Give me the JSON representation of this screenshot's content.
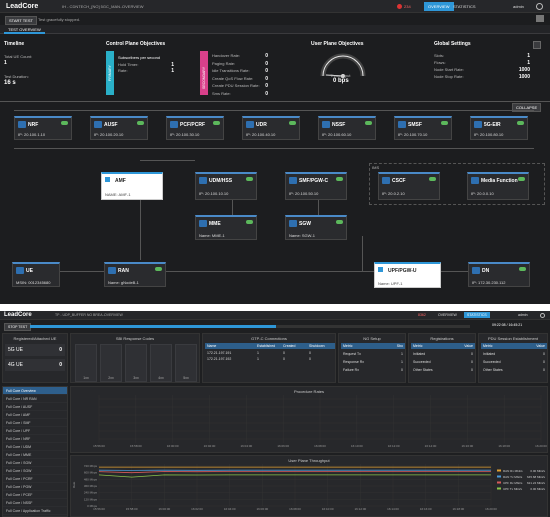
{
  "top": {
    "brand": "LeadCore",
    "breadcrumb_test": "IH - CDNTECH_[NO] 5GC_MAN...",
    "breadcrumb_page": "OVERVIEW",
    "alert_count": "234",
    "overview_button": "OVERVIEW",
    "statistics_label": "STATISTICS",
    "user": "admin",
    "start_button": "START TEST",
    "status_message": "Test gracefully stopped.",
    "tab_overview": "TEST OVERVIEW"
  },
  "timeline": {
    "title": "Timeline",
    "ue_label": "Total UE Count:",
    "ue_value": "1",
    "duration_label": "Test Duration:",
    "duration_value": "16 s"
  },
  "control_plane": {
    "title": "Control Plane Objectives",
    "primary_label": "PRIMARY",
    "secondary_label": "SECONDARY",
    "subscribers_header": "Subscribers per second",
    "primary_rows": [
      {
        "label": "Hold Timer:",
        "value": "1"
      },
      {
        "label": "Rate:",
        "value": "1"
      }
    ],
    "secondary_rows": [
      {
        "label": "Handover Rate:",
        "value": "0"
      },
      {
        "label": "Paging Rate:",
        "value": "0"
      },
      {
        "label": "Idle Transitions Rate:",
        "value": "0"
      },
      {
        "label": "Create QoS Flow Rate:",
        "value": "0"
      },
      {
        "label": "Create PDU Session Rate:",
        "value": "0"
      },
      {
        "label": "Sms Rate:",
        "value": "0"
      }
    ]
  },
  "user_plane": {
    "title": "User Plane Objectives",
    "gauge_label": "Throughput",
    "gauge_value": "0 bps",
    "gauge_ticks": [
      "0",
      "1",
      "2",
      "3",
      "4",
      "5",
      "6",
      "7",
      "8",
      "9",
      "10"
    ]
  },
  "global": {
    "title": "Global Settings",
    "rows": [
      {
        "label": "Slots:",
        "value": "1"
      },
      {
        "label": "Flows:",
        "value": "1"
      },
      {
        "label": "Node Start Rate:",
        "value": "1000"
      },
      {
        "label": "Node Stop Rate:",
        "value": "1000"
      }
    ]
  },
  "collapse_label": "COLLAPSE",
  "ims_label": "IMS",
  "nodes": [
    {
      "name": "NRF",
      "detail": "IP: 20.100.1.10"
    },
    {
      "name": "AUSF",
      "detail": "IP: 20.100.20.10"
    },
    {
      "name": "PCF/PCRF",
      "detail": "IP: 20.100.30.10"
    },
    {
      "name": "UDR",
      "detail": "IP: 20.100.40.10"
    },
    {
      "name": "NSSF",
      "detail": "IP: 20.100.60.10"
    },
    {
      "name": "SMSF",
      "detail": "IP: 20.100.70.10"
    },
    {
      "name": "5G-EIR",
      "detail": "IP: 20.100.80.10"
    },
    {
      "name": "AMF",
      "detail": "NAME: AMF-1"
    },
    {
      "name": "UDM/HSS",
      "detail": "IP: 20.100.10.10"
    },
    {
      "name": "SMF/PGW-C",
      "detail": "IP: 20.100.50.10"
    },
    {
      "name": "CSCF",
      "detail": "IP: 20.0.2.10"
    },
    {
      "name": "Media Function",
      "detail": "IP: 20.0.0.10"
    },
    {
      "name": "MME",
      "detail": "Name: MME-1"
    },
    {
      "name": "SGW",
      "detail": "Name: SGW-1"
    },
    {
      "name": "UE",
      "detail": "MSIN: 0012345680"
    },
    {
      "name": "RAN",
      "detail": "Name: gNodeB-1"
    },
    {
      "name": "UPF/PGW-U",
      "detail": "Name: UPF-1"
    },
    {
      "name": "DN",
      "detail": "IP: 172.30.230.112"
    }
  ],
  "stats": {
    "brand": "LeadCore",
    "alert_count": "8362",
    "overview_label": "OVERVIEW",
    "statistics_button": "STATISTICS",
    "user": "admin",
    "breadcrumb_test": "TP - UDP_BUFFER NO BREA...",
    "breadcrumb_page": "OVERVIEW",
    "stop_button": "STOP TEST",
    "elapsed": "09:22:08 / 16:45:21",
    "reg_title": "Registered/Attached UE",
    "ue_5g_label": "5G UE",
    "ue_5g_value": "0",
    "ue_4g_label": "4G UE",
    "ue_4g_value": "0",
    "sbi_title": "SBI Response Codes",
    "sbi_cols": [
      "1xx",
      "2xx",
      "3xx",
      "4xx",
      "5xx"
    ],
    "gtpc_title": "GTP-C Connections",
    "gtpc_headers": [
      "Name",
      "Established",
      "Created",
      "Shutdown"
    ],
    "gtpc_rows": [
      {
        "name": "172.21.197.191",
        "established": "1",
        "created": "0",
        "shutdown": "0"
      },
      {
        "name": "172.21.197.192",
        "established": "1",
        "created": "0",
        "shutdown": "0"
      }
    ],
    "ng_title": "NG Setup",
    "ng_headers": [
      "Metric",
      "Sbo"
    ],
    "ng_rows": [
      {
        "metric": "Request Tx",
        "value": "1"
      },
      {
        "metric": "Response Rx",
        "value": "1"
      },
      {
        "metric": "Failure Rx",
        "value": "0"
      }
    ],
    "reg_card_title": "Registrations",
    "reg_headers": [
      "Metric",
      "Value"
    ],
    "reg_rows": [
      {
        "metric": "Initiated",
        "value": "0"
      },
      {
        "metric": "Succeeded",
        "value": "0"
      },
      {
        "metric": "Other States",
        "value": "0"
      }
    ],
    "pdu_title": "PDU Session Establishment",
    "pdu_headers": [
      "Metric",
      "Value"
    ],
    "pdu_rows": [
      {
        "metric": "Initiated",
        "value": "0"
      },
      {
        "metric": "Succeeded",
        "value": "0"
      },
      {
        "metric": "Other States",
        "value": "0"
      }
    ],
    "sidebar": [
      "Full Core Overview",
      "Full Core / NR RAN",
      "Full Core / AUSF",
      "Full Core / AMF",
      "Full Core / SMF",
      "Full Core / UPF",
      "Full Core / NRF",
      "Full Core / UDM",
      "Full Core / MME",
      "Full Core / SGW",
      "Full Core / SGW",
      "Full Core / PCRF",
      "Full Core / PGW",
      "Full Core / PCEF",
      "Full Core / NSSF",
      "Full Core / Application Traffic",
      "Agent Statistics"
    ],
    "proc_title": "Procedure Rates",
    "tp_title": "User Plane Throughput",
    "tp_ylabel": "Rate",
    "tp_yticks": [
      "0 Mbps",
      "120 Mbps",
      "240 Mbps",
      "360 Mbps",
      "480 Mbps",
      "600 Mbps",
      "720 Mbps"
    ],
    "time_ticks": [
      "15:56:00",
      "15:58:00",
      "16:00:00",
      "16:02:00",
      "16:04:00",
      "16:06:00",
      "16:08:00",
      "16:10:00",
      "16:12:00",
      "16:14:00",
      "16:16:00",
      "16:18:00",
      "16:20:00"
    ],
    "tp_legend": [
      {
        "name": "RAN Rx Mbit/s",
        "value": "0.00 Mbit/s",
        "color": "#e0a030"
      },
      {
        "name": "RAN Tx Mbit/s",
        "value": "645.68 Mbit/s",
        "color": "#4a9ad8"
      },
      {
        "name": "UPF Rx Mbit/s",
        "value": "621.24 Mbit/s",
        "color": "#d85a5a"
      },
      {
        "name": "UPF Tx Mbit/s",
        "value": "0.00 Mbit/s",
        "color": "#8bc34a"
      }
    ]
  },
  "chart_data": {
    "type": "line",
    "title": "User Plane Throughput",
    "ylabel": "Rate",
    "x": [
      "15:56:00",
      "15:58:00",
      "16:00:00",
      "16:02:00",
      "16:04:00",
      "16:06:00",
      "16:08:00",
      "16:10:00",
      "16:12:00",
      "16:14:00",
      "16:16:00",
      "16:18:00",
      "16:20:00"
    ],
    "ylim": [
      0,
      720
    ],
    "series": [
      {
        "name": "RAN Rx Mbit/s",
        "values": [
          700,
          700,
          700,
          700,
          700,
          700,
          700,
          700,
          700,
          700,
          700,
          700,
          700
        ]
      },
      {
        "name": "RAN Tx Mbit/s",
        "values": [
          645,
          640,
          645,
          643,
          645,
          645,
          644,
          645,
          645,
          645,
          645,
          645,
          645
        ]
      },
      {
        "name": "UPF Rx Mbit/s",
        "values": [
          620,
          600,
          621,
          618,
          621,
          621,
          620,
          621,
          621,
          621,
          621,
          621,
          621
        ]
      },
      {
        "name": "UPF Tx Mbit/s",
        "values": [
          560,
          520,
          560,
          558,
          560,
          560,
          559,
          560,
          560,
          560,
          560,
          560,
          560
        ]
      }
    ]
  }
}
